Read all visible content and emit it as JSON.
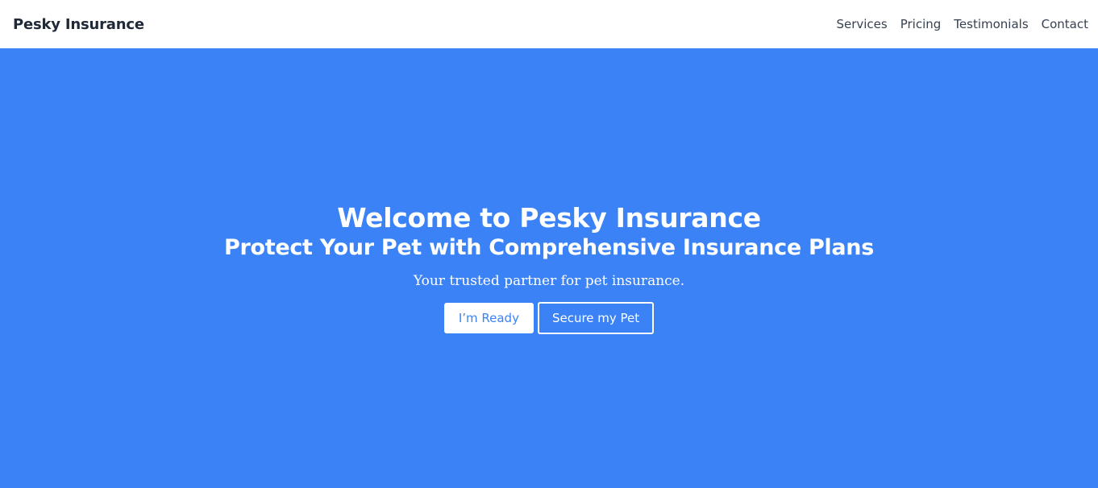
{
  "navbar": {
    "brand": "Pesky Insurance",
    "links": [
      {
        "label": "Services"
      },
      {
        "label": "Pricing"
      },
      {
        "label": "Testimonials"
      },
      {
        "label": "Contact"
      }
    ]
  },
  "hero": {
    "title": "Welcome to Pesky Insurance",
    "subtitle": "Protect Your Pet with Comprehensive Insurance Plans",
    "tagline": "Your trusted partner for pet insurance.",
    "primary_button": "I’m Ready",
    "secondary_button": "Secure my Pet"
  },
  "colors": {
    "hero_background": "#3b82f6",
    "navbar_background": "#ffffff",
    "brand_text": "#1f2937",
    "nav_text": "#374151"
  }
}
